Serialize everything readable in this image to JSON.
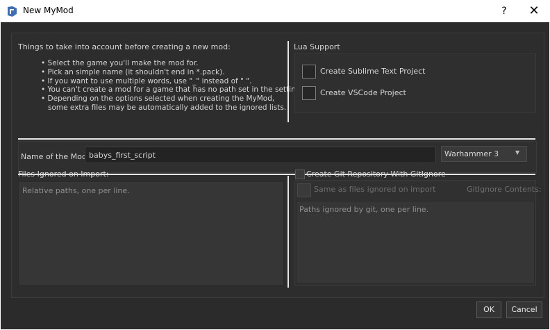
{
  "window": {
    "title": "New MyMod",
    "help_label": "?",
    "close_label": "✕"
  },
  "info": {
    "heading": "Things to take into account before creating a new mod:",
    "bullets": [
      "• Select the game you'll make the mod for.",
      "• Pick an simple name (it shouldn't end in *.pack).",
      "• If you want to use multiple words, use \"_\" instead of \" \".",
      "• You can't create a mod for a game that has no path set in the settings.",
      "• Depending on the options selected when creating the MyMod,",
      "   some extra files may be automatically added to the ignored lists."
    ]
  },
  "lua": {
    "heading": "Lua Support",
    "sublime_label": "Create Sublime Text Project",
    "vscode_label": "Create VSCode Project"
  },
  "mod": {
    "name_label": "Name of the Mod:",
    "name_value": "babys_first_script",
    "game_selected": "Warhammer 3",
    "dropdown_arrow": "▼"
  },
  "ignored": {
    "heading": "Files Ignored on Import:",
    "placeholder": "Relative paths, one per line."
  },
  "git": {
    "create_label": "Create Git Repository With GitIgnore",
    "same_as_label": "Same as files ignored on import",
    "contents_label": "GitIgnore Contents:",
    "placeholder": "Paths ignored by git, one per line."
  },
  "buttons": {
    "ok": "OK",
    "cancel": "Cancel"
  }
}
